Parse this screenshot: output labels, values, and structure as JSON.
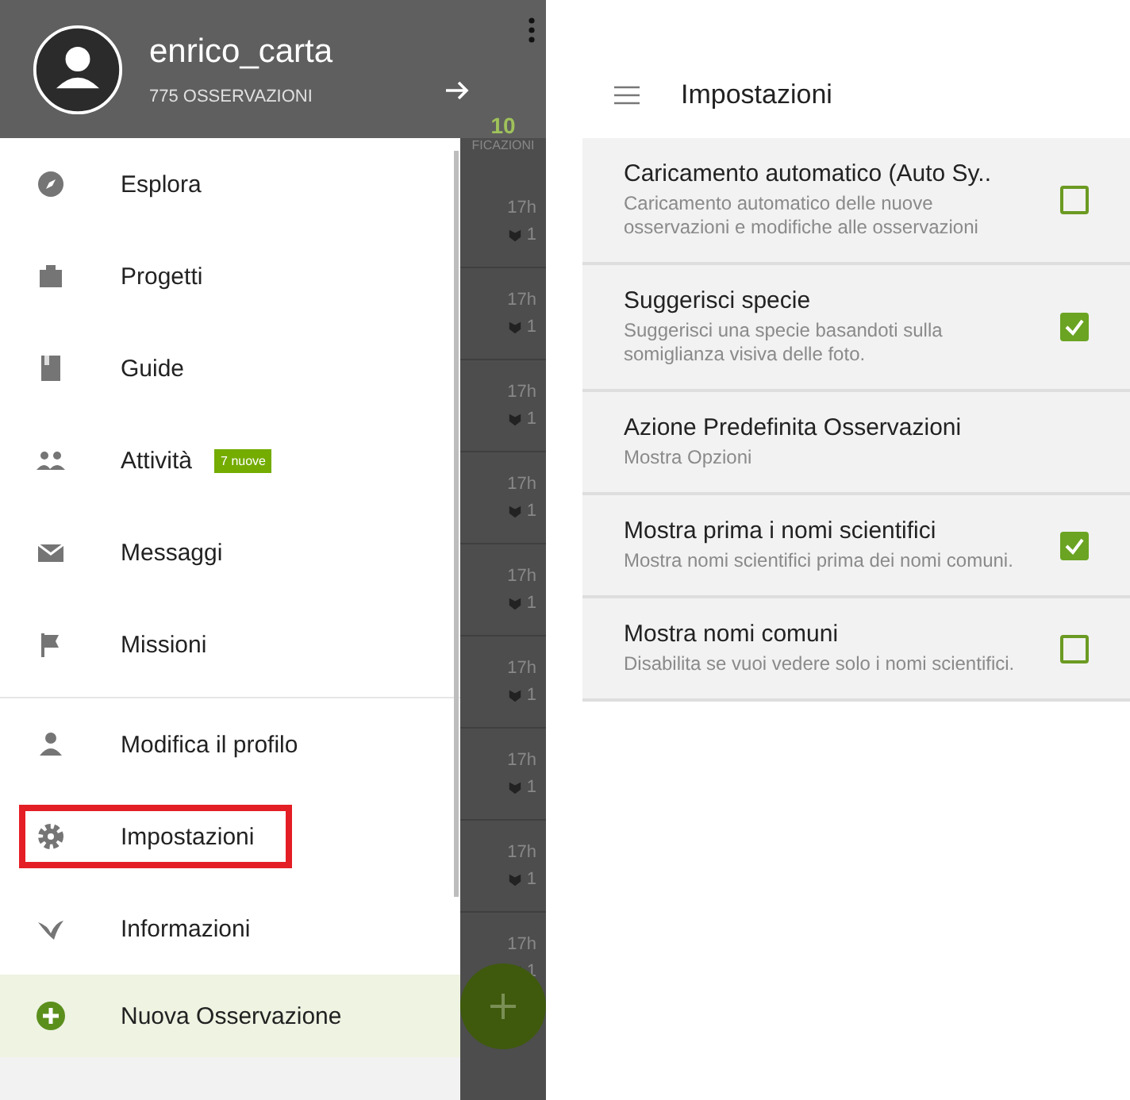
{
  "drawer": {
    "username": "enrico_carta",
    "observations": "775 OSSERVAZIONI",
    "items": [
      {
        "label": "Esplora",
        "highlighted": false
      },
      {
        "label": "Progetti",
        "highlighted": false
      },
      {
        "label": "Guide",
        "highlighted": false
      },
      {
        "label": "Attività",
        "highlighted": false,
        "badge": "7 nuove"
      },
      {
        "label": "Messaggi",
        "highlighted": false
      },
      {
        "label": "Missioni",
        "highlighted": false
      },
      {
        "label": "Modifica il profilo",
        "highlighted": false,
        "divider_before": true
      },
      {
        "label": "Impostazioni",
        "highlighted": true
      },
      {
        "label": "Informazioni",
        "highlighted": false
      }
    ],
    "new_observation": "Nuova Osservazione"
  },
  "background_list": {
    "count": "10",
    "count_label": "FICAZIONI",
    "rows": [
      {
        "time": "17h",
        "count": "1"
      },
      {
        "time": "17h",
        "count": "1"
      },
      {
        "time": "17h",
        "count": "1"
      },
      {
        "time": "17h",
        "count": "1"
      },
      {
        "time": "17h",
        "count": "1"
      },
      {
        "time": "17h",
        "count": "1"
      },
      {
        "time": "17h",
        "count": "1"
      },
      {
        "time": "17h",
        "count": "1"
      },
      {
        "time": "17h",
        "count": "1"
      }
    ]
  },
  "settings": {
    "title": "Impostazioni",
    "rows": [
      {
        "kind": "checkbox",
        "title": "Caricamento automatico (Auto Sy..",
        "description": "Caricamento automatico delle nuove osservazioni e modifiche alle osservazioni",
        "checked": false
      },
      {
        "kind": "checkbox",
        "title": "Suggerisci specie",
        "description": "Suggerisci una specie basandoti sulla somiglianza visiva delle foto.",
        "checked": true
      },
      {
        "kind": "plain",
        "title": "Azione Predefinita Osservazioni",
        "description": "Mostra Opzioni"
      },
      {
        "kind": "checkbox",
        "title": "Mostra prima i nomi scientifici",
        "description": "Mostra nomi scientifici prima dei nomi comuni.",
        "checked": true
      },
      {
        "kind": "checkbox",
        "title": "Mostra nomi comuni",
        "description": "Disabilita se vuoi vedere solo i nomi scientifici.",
        "checked": false
      }
    ]
  }
}
